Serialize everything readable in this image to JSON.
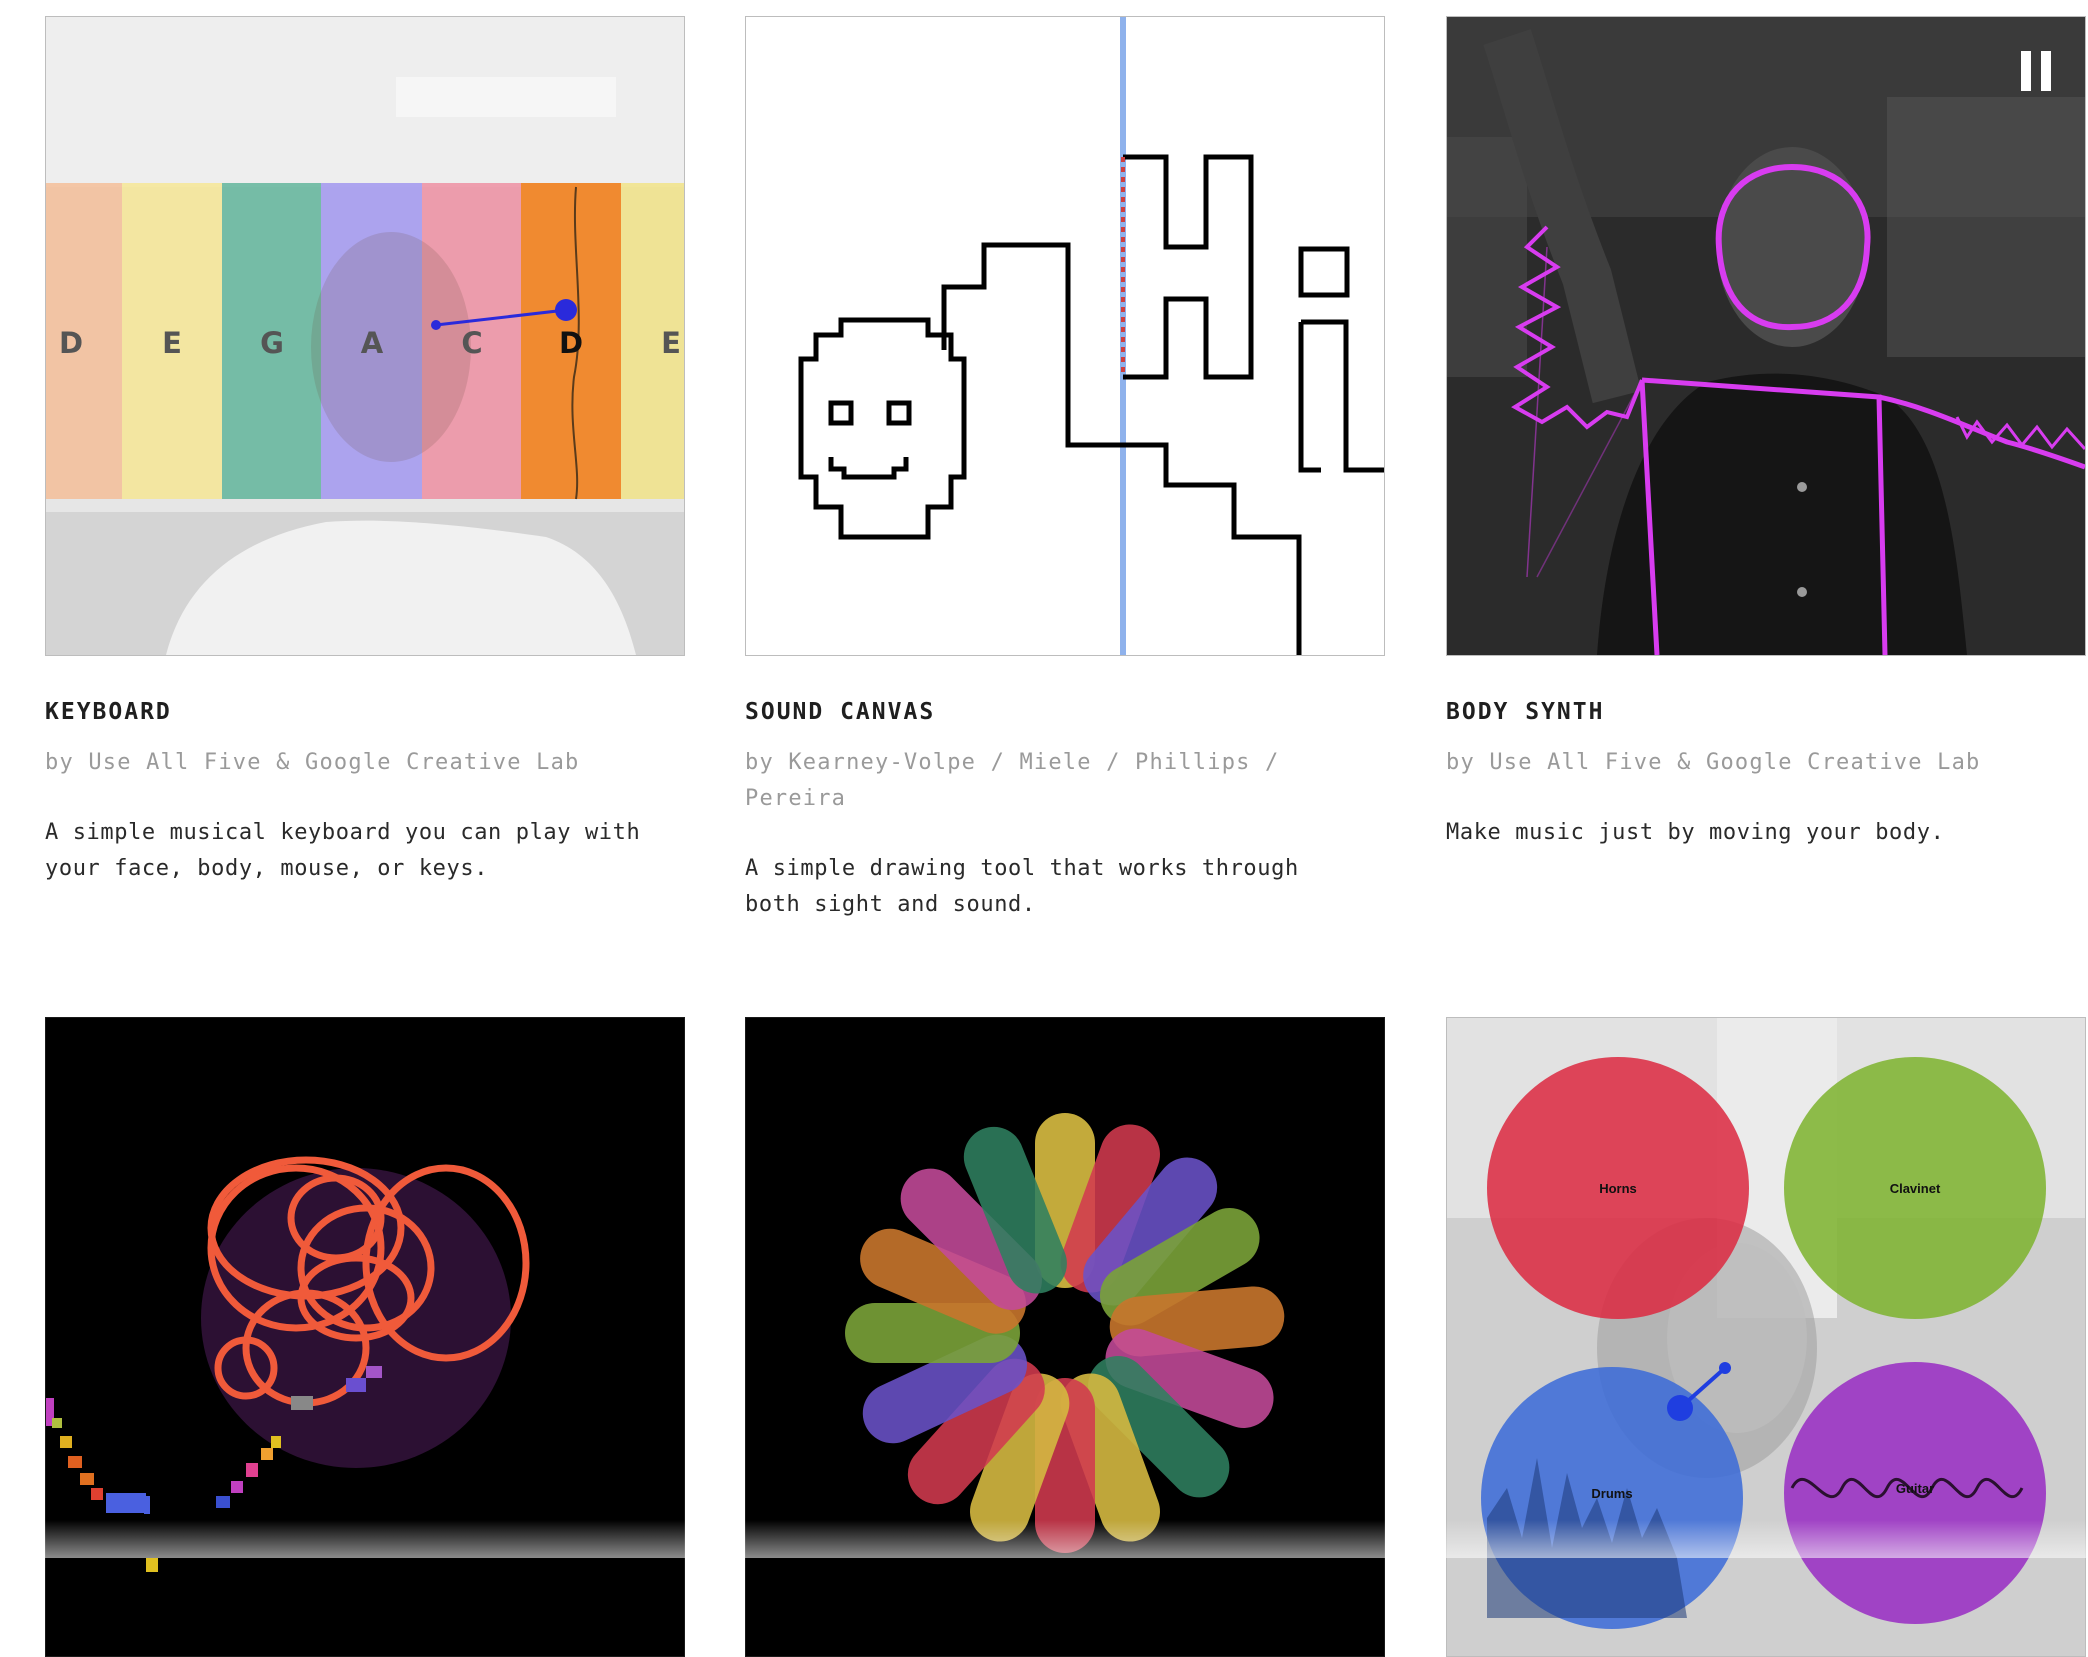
{
  "experiments": [
    {
      "title": "KEYBOARD",
      "byline": "by Use All Five & Google Creative Lab",
      "description": "A simple musical keyboard you can play with your face, body, mouse, or keys.",
      "keys": [
        "D",
        "E",
        "G",
        "A",
        "C",
        "D",
        "E"
      ]
    },
    {
      "title": "SOUND CANVAS",
      "byline": "by Kearney-Volpe / Miele / Phillips / Pereira",
      "description": "A simple drawing tool that works through both sight and sound."
    },
    {
      "title": "BODY SYNTH",
      "byline": "by Use All Five & Google Creative Lab",
      "description": "Make music just by moving your body."
    }
  ],
  "instrument_circles": [
    "Horns",
    "Clavinet",
    "Drums",
    "Guitar"
  ],
  "icons": {
    "pause": "pause-icon"
  },
  "colors": {
    "magenta": "#d83cf0",
    "keyboard_active": "#f08a30",
    "pointer_blue": "#2a2adb"
  }
}
